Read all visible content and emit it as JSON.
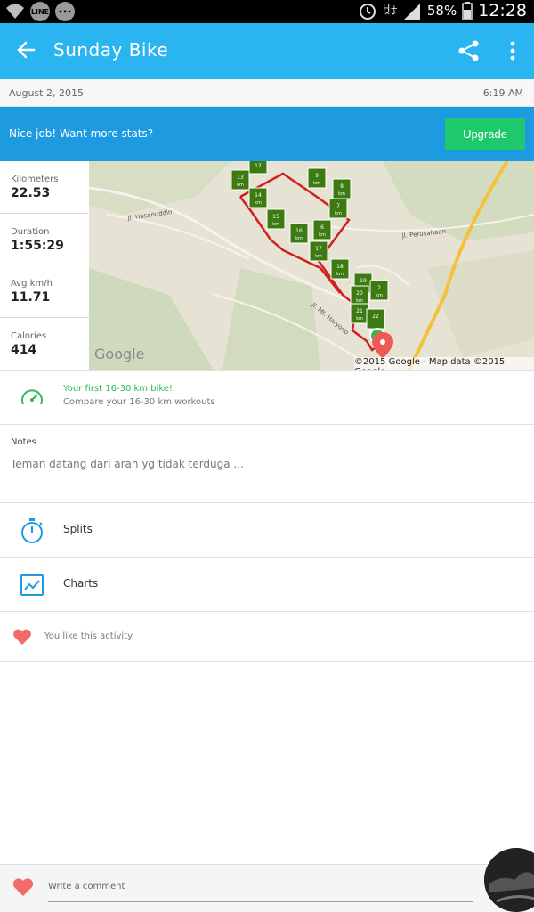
{
  "status_bar": {
    "left_icons": [
      "wifi-icon",
      "line-app-icon",
      "notification-app-icon"
    ],
    "line_label": "LINE",
    "battery_percent": "58%",
    "time": "12:28"
  },
  "app_bar": {
    "title": "Sunday Bike",
    "back_icon": "arrow-left-icon",
    "share_icon": "share-icon",
    "more_icon": "more-vert-icon"
  },
  "activity": {
    "date": "August 2, 2015",
    "time": "6:19 AM"
  },
  "banner": {
    "text": "Nice job! Want more stats?",
    "button_label": "Upgrade"
  },
  "stats": [
    {
      "label": "Kilometers",
      "value": "22.53"
    },
    {
      "label": "Duration",
      "value": "1:55:29"
    },
    {
      "label": "Avg km/h",
      "value": "11.71"
    },
    {
      "label": "Calories",
      "value": "414"
    }
  ],
  "map": {
    "attribution_logo": "Google",
    "copyright": "©2015 Google - Map data ©2015 Google",
    "road_labels": [
      "Jl. Hasanuddin",
      "Jl. Perusahaan",
      "Jl. Mt. Haryono"
    ],
    "km_markers": [
      "12",
      "13",
      "14",
      "15",
      "16",
      "17",
      "18",
      "19",
      "20",
      "21",
      "22",
      "9",
      "8",
      "7",
      "6",
      "2"
    ],
    "km_unit": "km"
  },
  "achievement": {
    "title": "Your first 16-30 km bike!",
    "subtitle": "Compare your 16-30 km workouts",
    "icon": "speedometer-icon"
  },
  "notes": {
    "label": "Notes",
    "text": "Teman datang dari arah yg tidak terduga ..."
  },
  "rows": [
    {
      "label": "Splits",
      "icon": "stopwatch-icon"
    },
    {
      "label": "Charts",
      "icon": "chart-icon"
    }
  ],
  "like": {
    "text": "You like this activity",
    "icon": "heart-icon"
  },
  "comment": {
    "placeholder": "Write a comment"
  },
  "colors": {
    "app_bar": "#2ab4f0",
    "banner": "#1e9be0",
    "upgrade_button": "#1ec96e",
    "achievement_text": "#2cb95a",
    "route": "#d21f1f",
    "marker": "#3d7a12",
    "heart": "#f06b6b"
  }
}
